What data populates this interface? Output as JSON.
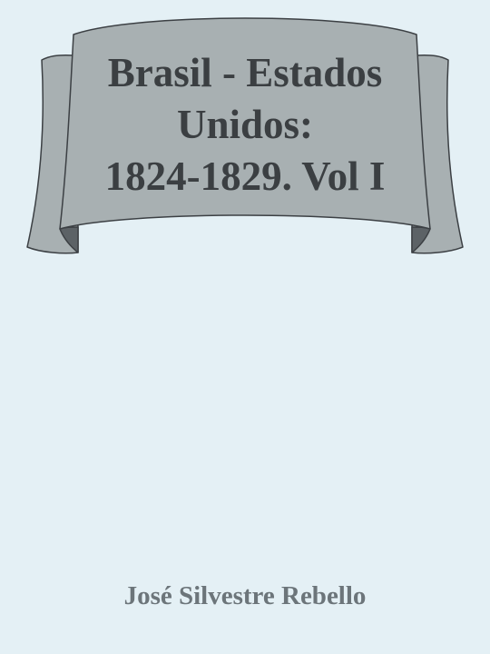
{
  "book": {
    "title_lines": [
      "Brasil - Estados",
      "Unidos:",
      "1824-1829. Vol I"
    ],
    "author": "José Silvestre Rebello"
  },
  "colors": {
    "background": "#e4f0f5",
    "banner_fill": "#a8b0b2",
    "banner_fold": "#5c6266",
    "banner_stroke": "#3c4044",
    "title_text": "#3b3f42",
    "author_text": "#6c757a"
  }
}
